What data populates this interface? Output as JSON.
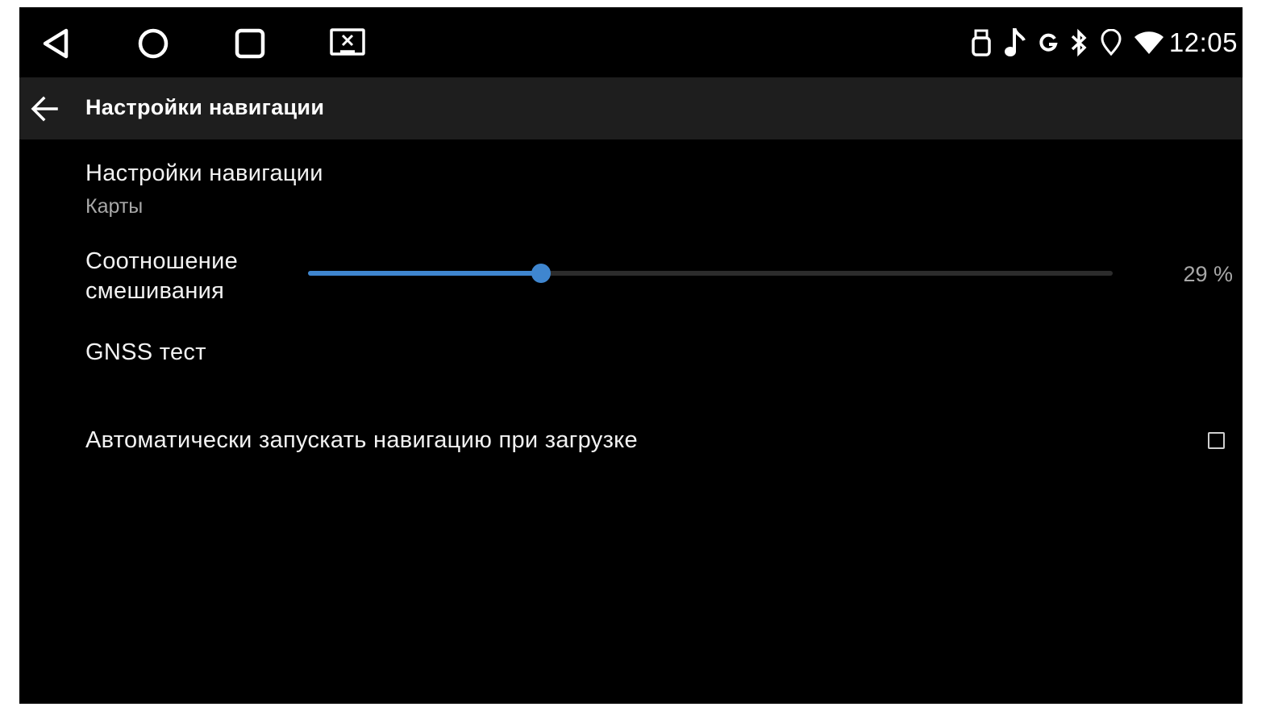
{
  "theme": {
    "background": "#000000",
    "toolbar_background": "#1e1e1e",
    "accent": "#3f86cf",
    "text_primary": "#f2f2f2",
    "text_secondary": "#a8a8a8"
  },
  "status_bar": {
    "nav_buttons": [
      {
        "icon": "triangle-back-icon"
      },
      {
        "icon": "circle-home-icon"
      },
      {
        "icon": "square-recents-icon"
      },
      {
        "icon": "screenshot-icon"
      }
    ],
    "indicators": [
      "usb-icon",
      "music-note-icon",
      "google-icon",
      "bluetooth-icon",
      "location-icon",
      "wifi-icon"
    ],
    "clock": "12:05"
  },
  "toolbar": {
    "back_icon": "arrow-left-icon",
    "title": "Настройки навигации"
  },
  "preferences": {
    "nav_app": {
      "title": "Настройки навигации",
      "summary": "Карты"
    },
    "mix_ratio": {
      "title": "Соотношение смешивания",
      "value": 29,
      "value_text": "29 %"
    },
    "gnss_test": {
      "title": "GNSS тест"
    },
    "autostart": {
      "title": "Автоматически запускать навигацию при загрузке",
      "checked": false
    }
  }
}
